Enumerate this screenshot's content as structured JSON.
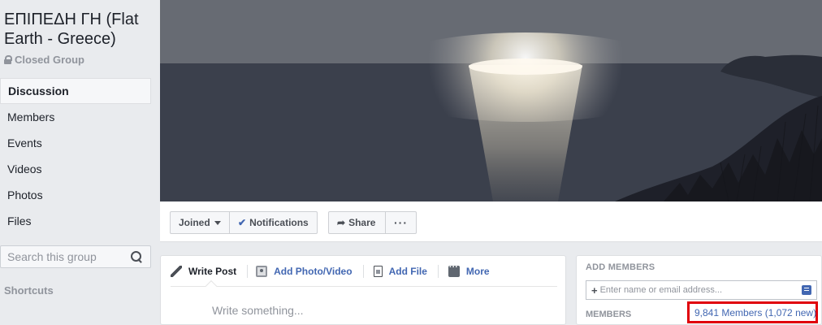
{
  "group": {
    "title": "ΕΠΙΠΕΔΗ ΓΗ (Flat Earth - Greece)",
    "privacy": "Closed Group"
  },
  "sidebar": {
    "items": [
      {
        "label": "Discussion",
        "active": true
      },
      {
        "label": "Members"
      },
      {
        "label": "Events"
      },
      {
        "label": "Videos"
      },
      {
        "label": "Photos"
      },
      {
        "label": "Files"
      }
    ],
    "search_placeholder": "Search this group",
    "shortcuts_label": "Shortcuts"
  },
  "actions": {
    "joined": "Joined",
    "notifications": "Notifications",
    "share": "Share",
    "more": "···"
  },
  "composer": {
    "tabs": [
      "Write Post",
      "Add Photo/Video",
      "Add File",
      "More"
    ],
    "placeholder": "Write something..."
  },
  "right": {
    "add_members_label": "ADD MEMBERS",
    "add_members_placeholder": "Enter name or email address...",
    "members_label": "MEMBERS",
    "members_count": "9,841 Members (1,072 new)",
    "highlight_color": "#e0000a"
  },
  "colors": {
    "link": "#4267b2",
    "background": "#e9ebee"
  }
}
